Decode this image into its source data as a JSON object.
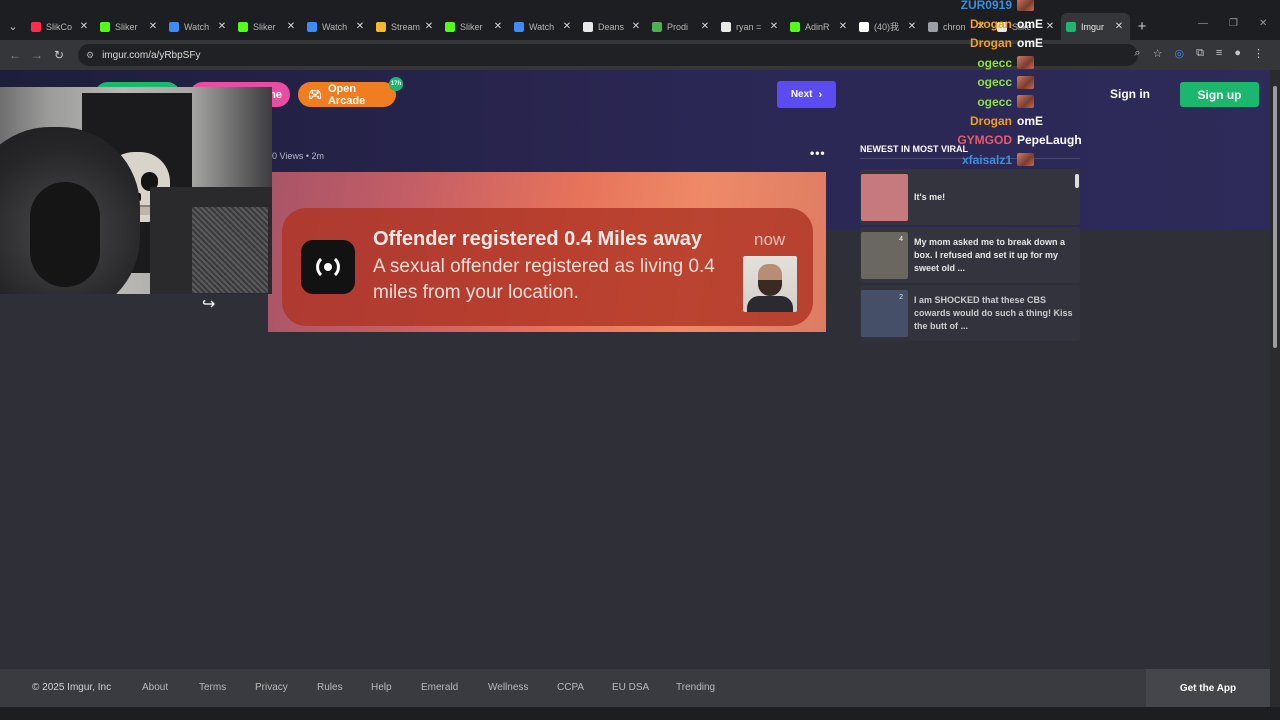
{
  "browser": {
    "tabs": [
      {
        "title": "SlikCo",
        "icon_color": "#ff2d4b",
        "icon": "youtube-icon"
      },
      {
        "title": "Sliker",
        "icon_color": "#53fc18",
        "icon": "kick-icon"
      },
      {
        "title": "Watch",
        "icon_color": "#3b8cf5",
        "icon": "loop-icon"
      },
      {
        "title": "Sliker",
        "icon_color": "#53fc18",
        "icon": "kick-icon"
      },
      {
        "title": "Watch",
        "icon_color": "#3b8cf5",
        "icon": "loop-icon"
      },
      {
        "title": "Stream",
        "icon_color": "#f5b82e",
        "icon": "bar-chart-icon"
      },
      {
        "title": "Sliker",
        "icon_color": "#53fc18",
        "icon": "kick-icon"
      },
      {
        "title": "Watch",
        "icon_color": "#3b8cf5",
        "icon": "loop-icon"
      },
      {
        "title": "Deans",
        "icon_color": "#e8e8e8",
        "icon": "x-logo-icon"
      },
      {
        "title": "Prodi",
        "icon_color": "#4caf50",
        "icon": "leaf-icon"
      },
      {
        "title": "ryan =",
        "icon_color": "#e8e8e8",
        "icon": "x-logo-icon"
      },
      {
        "title": "AdinR",
        "icon_color": "#53fc18",
        "icon": "kick-icon"
      },
      {
        "title": "(40)我",
        "icon_color": "#ffffff",
        "icon": "tiktok-icon"
      },
      {
        "title": "chron",
        "icon_color": "#9aa0a6",
        "icon": "globe-icon"
      },
      {
        "title": "Slike",
        "icon_color": "#e8e8e8",
        "icon": "x-logo-icon"
      },
      {
        "title": "Imgur",
        "icon_color": "#1bb76e",
        "icon": "imgur-icon"
      }
    ],
    "url": "imgur.com/a/yRbpSFy"
  },
  "header": {
    "arcade_label": "Open Arcade",
    "arcade_badge": "17h",
    "pink_pill_label": "me",
    "next_label": "Next",
    "signin_label": "Sign in",
    "signup_label": "Sign up"
  },
  "post": {
    "meta": "0 Views  •  2m",
    "more": "•••"
  },
  "notification": {
    "title": "Offender registered 0.4 Miles away",
    "time": "now",
    "body": "A sexual offender registered as living 0.4 miles from your location."
  },
  "sidebar": {
    "title": "NEWEST IN MOST VIRAL",
    "items": [
      {
        "text": "It's me!",
        "count": "",
        "thumb": "#c77a7e"
      },
      {
        "text": "My mom asked me to break down a box. I refused and set it up for my sweet old ...",
        "count": "4",
        "thumb": "#6a6760"
      },
      {
        "text": "I am SHOCKED that these CBS cowards would do such a thing! Kiss the butt of ...",
        "count": "2",
        "thumb": "#4a5570"
      }
    ]
  },
  "footer": {
    "copyright": "© 2025 Imgur, Inc",
    "links": [
      "About",
      "Terms",
      "Privacy",
      "Rules",
      "Help",
      "Emerald",
      "Wellness",
      "CCPA",
      "EU DSA",
      "Trending"
    ],
    "get_app": "Get the App"
  },
  "chat": [
    {
      "user": "ZUR0919",
      "color": "#3a8fe0",
      "msg": "",
      "emote": true
    },
    {
      "user": "Drogan",
      "color": "#f0a020",
      "msg": "omE",
      "emote": false
    },
    {
      "user": "Drogan",
      "color": "#f0a020",
      "msg": "omE",
      "emote": false
    },
    {
      "user": "ogecc",
      "color": "#8ee04a",
      "msg": "",
      "emote": true
    },
    {
      "user": "ogecc",
      "color": "#8ee04a",
      "msg": "",
      "emote": true
    },
    {
      "user": "ogecc",
      "color": "#8ee04a",
      "msg": "",
      "emote": true
    },
    {
      "user": "Drogan",
      "color": "#f0a020",
      "msg": "omE",
      "emote": false
    },
    {
      "user": "GYMGOD",
      "color": "#e85a6a",
      "msg": "PepeLaugh",
      "emote": false
    },
    {
      "user": "xfaisalz1",
      "color": "#3a8fe0",
      "msg": "",
      "emote": true
    }
  ]
}
